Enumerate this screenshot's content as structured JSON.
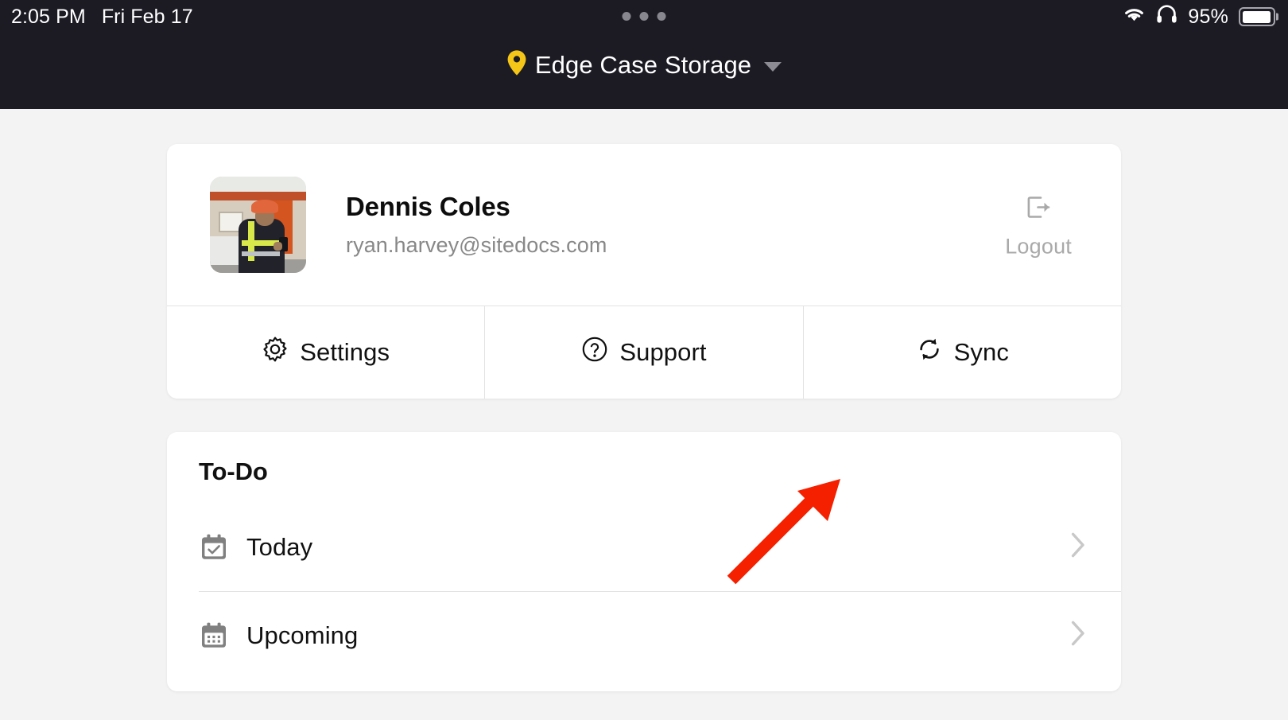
{
  "status_bar": {
    "time": "2:05 PM",
    "date": "Fri Feb 17",
    "battery_percent": "95%",
    "wifi_icon": "wifi-icon",
    "headphones_icon": "headphones-icon",
    "battery_icon": "battery-icon",
    "dots_indicator": "three-dots-icon"
  },
  "header": {
    "site_name": "Edge Case Storage",
    "pin_icon": "map-pin-icon",
    "pin_color": "#f5c518",
    "dropdown_icon": "chevron-down-icon",
    "background_color": "#1c1b24"
  },
  "profile": {
    "name": "Dennis Coles",
    "email": "ryan.harvey@sitedocs.com",
    "avatar_icon": "user-avatar-photo",
    "logout": {
      "label": "Logout",
      "icon": "logout-icon"
    }
  },
  "actions": [
    {
      "label": "Settings",
      "icon": "gear-icon"
    },
    {
      "label": "Support",
      "icon": "question-circle-icon"
    },
    {
      "label": "Sync",
      "icon": "refresh-sync-icon"
    }
  ],
  "todo": {
    "title": "To-Do",
    "items": [
      {
        "label": "Today",
        "icon": "calendar-check-icon",
        "chevron": "chevron-right-icon"
      },
      {
        "label": "Upcoming",
        "icon": "calendar-dots-icon",
        "chevron": "chevron-right-icon"
      }
    ]
  },
  "annotation": {
    "arrow_icon": "red-arrow-icon",
    "arrow_color": "#f42000",
    "points_to": "Sync"
  },
  "colors": {
    "page_background": "#f3f3f3",
    "card_background": "#ffffff",
    "divider": "#e3e3e3",
    "muted_text": "#888888"
  }
}
